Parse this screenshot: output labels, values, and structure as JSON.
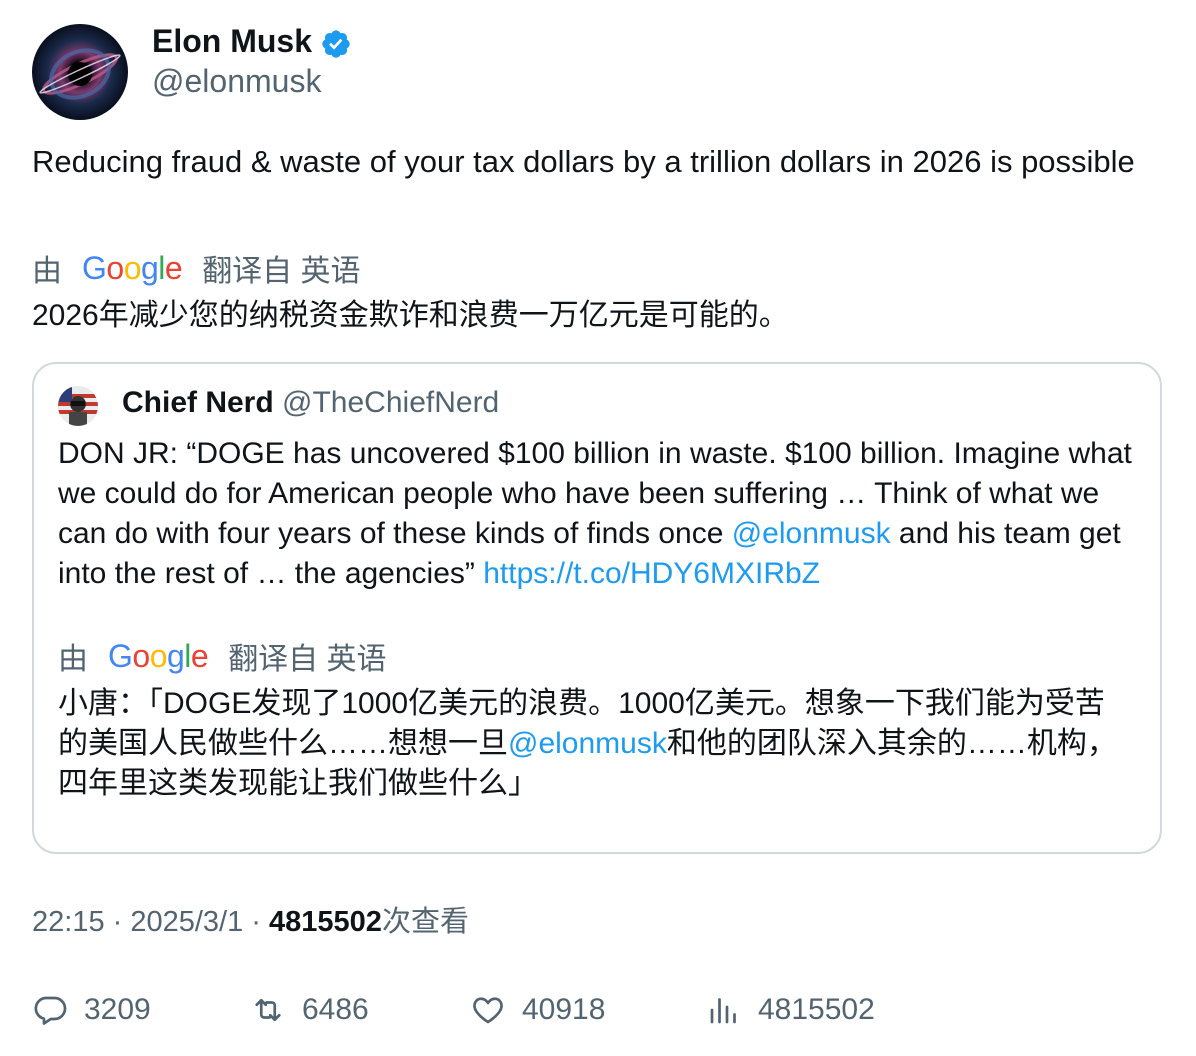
{
  "author": {
    "name": "Elon Musk",
    "handle": "@elonmusk",
    "avatar_icon": "black-hole-avatar",
    "verified_color": "#1d9bf0"
  },
  "tweet": {
    "text": "Reducing fraud & waste of your tax dollars by a trillion dollars in 2026 is possible",
    "translation_label_by": "由",
    "translation_label_from": "翻译自 英语",
    "translation_text": "2026年减少您的纳税资金欺诈和浪费一万亿元是可能的。"
  },
  "google_logo": [
    "G",
    "o",
    "o",
    "g",
    "l",
    "e"
  ],
  "quoted": {
    "name": "Chief Nerd",
    "handle": "@TheChiefNerd",
    "text_part1": "DON JR: “DOGE has uncovered $100 billion in waste. $100 billion. Imagine what we could do for American people who have been suffering … Think of what we can do with four years of these kinds of finds once ",
    "mention": "@elonmusk",
    "text_part2": " and his team get into the rest of … the agencies” ",
    "link": "https://t.co/HDY6MXIRbZ",
    "translation_label_by": "由",
    "translation_label_from": "翻译自 英语",
    "translation_part1": "小唐：「DOGE发现了1000亿美元的浪费。1000亿美元。想象一下我们能为受苦的美国人民做些什么……想想一旦",
    "translation_mention": "@elonmusk",
    "translation_part2": "和他的团队深入其余的……机构，四年里这类发现能让我们做些什么」"
  },
  "meta": {
    "time": "22:15",
    "sep1": " · ",
    "date": "2025/3/1",
    "sep2": " · ",
    "views": "4815502",
    "views_suffix": "次查看"
  },
  "stats": {
    "replies": "3209",
    "reposts": "6486",
    "likes": "40918",
    "views": "4815502"
  },
  "colors": {
    "text": "#0f1419",
    "secondary": "#536471",
    "link": "#1d9bf0",
    "border": "#cfd9de"
  }
}
